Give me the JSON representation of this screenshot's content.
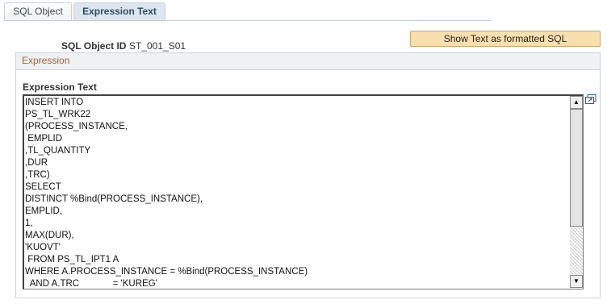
{
  "tabs": [
    {
      "label": "SQL Object",
      "active": false
    },
    {
      "label": "Expression Text",
      "active": true
    }
  ],
  "sql_object_id": {
    "label": "SQL Object ID",
    "value": "ST_001_S01"
  },
  "format_button": {
    "label": "Show Text as formatted SQL"
  },
  "expression_group": {
    "title": "Expression"
  },
  "expression_text": {
    "label": "Expression Text",
    "value": "INSERT INTO\nPS_TL_WRK22\n(PROCESS_INSTANCE,\n EMPLID\n,TL_QUANTITY\n,DUR\n,TRC)\nSELECT\nDISTINCT %Bind(PROCESS_INSTANCE),\nEMPLID,\n1,\nMAX(DUR),\n'KUOVT'\n FROM PS_TL_IPT1 A\nWHERE A.PROCESS_INSTANCE = %Bind(PROCESS_INSTANCE)\n  AND A.TRC             = 'KUREG'"
  },
  "icons": {
    "expand": "expand-field-icon",
    "scroll_up": "scroll-up-arrow-icon",
    "scroll_down": "scroll-down-arrow-icon"
  },
  "colors": {
    "button_bg": "#f7dfb0",
    "group_title": "#b05d2a",
    "tab_active_bg": "#dde6ee"
  }
}
